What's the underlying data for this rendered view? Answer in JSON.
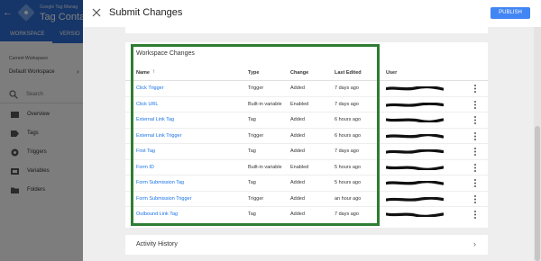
{
  "app": {
    "account_name": "Google Tag Manag",
    "container_name": "Tag Contain",
    "back_icon": "arrow-left-icon",
    "tabs": [
      {
        "label": "WORKSPACE"
      },
      {
        "label": "VERSIO"
      }
    ],
    "current_workspace_label": "Current Workspace",
    "workspace_name": "Default Workspace",
    "workspace_chevron": "›",
    "search_placeholder": "Search",
    "nav": [
      {
        "label": "Overview",
        "icon": "overview-icon"
      },
      {
        "label": "Tags",
        "icon": "tag-icon"
      },
      {
        "label": "Triggers",
        "icon": "trigger-icon"
      },
      {
        "label": "Variables",
        "icon": "variables-icon"
      },
      {
        "label": "Folders",
        "icon": "folder-icon"
      }
    ]
  },
  "dialog": {
    "title": "Submit Changes",
    "close_icon": "close-icon",
    "publish_label": "PUBLISH",
    "workspace_changes": {
      "title": "Workspace Changes",
      "columns": {
        "name": "Name",
        "type": "Type",
        "change": "Change",
        "last_edited": "Last Edited",
        "user": "User"
      },
      "sort_indicator": "↑",
      "rows": [
        {
          "name": "Click Trigger",
          "type": "Trigger",
          "change": "Added",
          "last_edited": "7 days ago"
        },
        {
          "name": "Click URL",
          "type": "Built-in variable",
          "change": "Enabled",
          "last_edited": "7 days ago"
        },
        {
          "name": "External Link Tag",
          "type": "Tag",
          "change": "Added",
          "last_edited": "6 hours ago"
        },
        {
          "name": "External Link Trigger",
          "type": "Trigger",
          "change": "Added",
          "last_edited": "6 hours ago"
        },
        {
          "name": "First Tag",
          "type": "Tag",
          "change": "Added",
          "last_edited": "7 days ago"
        },
        {
          "name": "Form ID",
          "type": "Built-in variable",
          "change": "Enabled",
          "last_edited": "5 hours ago"
        },
        {
          "name": "Form Submission Tag",
          "type": "Tag",
          "change": "Added",
          "last_edited": "5 hours ago"
        },
        {
          "name": "Form Submission Trigger",
          "type": "Trigger",
          "change": "Added",
          "last_edited": "an hour ago"
        },
        {
          "name": "Outbound Link Tag",
          "type": "Tag",
          "change": "Added",
          "last_edited": "7 days ago"
        }
      ]
    },
    "activity_history": {
      "label": "Activity History",
      "chevron": "›"
    }
  },
  "colors": {
    "brand_blue": "#2d6bd0",
    "publish_blue": "#4285f4",
    "link_blue": "#1a73e8",
    "highlight_green": "#2e7d32"
  }
}
